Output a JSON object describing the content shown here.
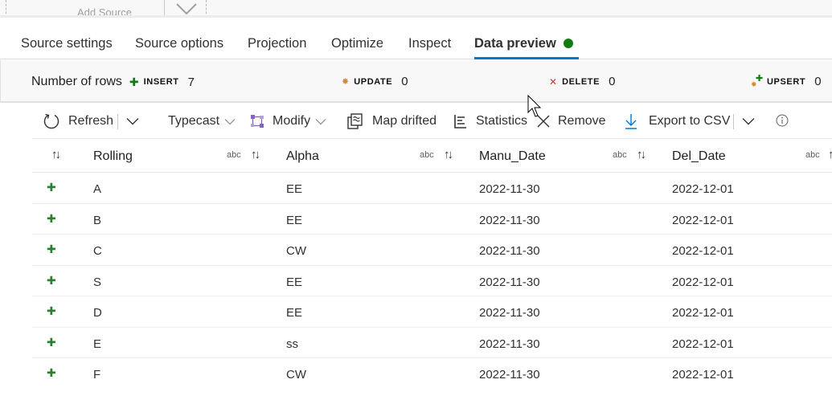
{
  "canvas": {
    "add_source_label": "Add Source"
  },
  "tabs": [
    {
      "label": "Source settings",
      "active": false
    },
    {
      "label": "Source options",
      "active": false
    },
    {
      "label": "Projection",
      "active": false
    },
    {
      "label": "Optimize",
      "active": false
    },
    {
      "label": "Inspect",
      "active": false
    },
    {
      "label": "Data preview",
      "active": true,
      "status": "green-dot"
    }
  ],
  "summary": {
    "title": "Number of rows",
    "insert": {
      "label": "INSERT",
      "count": "7",
      "icon": "plus-icon"
    },
    "update": {
      "label": "UPDATE",
      "count": "0",
      "icon": "sun-icon"
    },
    "delete": {
      "label": "DELETE",
      "count": "0",
      "icon": "x-icon"
    },
    "upsert": {
      "label": "UPSERT",
      "count": "0",
      "icon": "upsert-icon"
    }
  },
  "toolbar": {
    "refresh": "Refresh",
    "typecast": "Typecast",
    "modify": "Modify",
    "map_drifted": "Map drifted",
    "statistics": "Statistics",
    "remove": "Remove",
    "export_csv": "Export to CSV"
  },
  "table": {
    "columns": [
      {
        "name": "Rolling",
        "type": "abc"
      },
      {
        "name": "Alpha",
        "type": "abc"
      },
      {
        "name": "Manu_Date",
        "type": "abc"
      },
      {
        "name": "Del_Date",
        "type": "abc"
      }
    ],
    "rows": [
      {
        "Rolling": "A",
        "Alpha": "EE",
        "Manu_Date": "2022-11-30",
        "Del_Date": "2022-12-01"
      },
      {
        "Rolling": "B",
        "Alpha": "EE",
        "Manu_Date": "2022-11-30",
        "Del_Date": "2022-12-01"
      },
      {
        "Rolling": "C",
        "Alpha": "CW",
        "Manu_Date": "2022-11-30",
        "Del_Date": "2022-12-01"
      },
      {
        "Rolling": "S",
        "Alpha": "EE",
        "Manu_Date": "2022-11-30",
        "Del_Date": "2022-12-01"
      },
      {
        "Rolling": "D",
        "Alpha": "EE",
        "Manu_Date": "2022-11-30",
        "Del_Date": "2022-12-01"
      },
      {
        "Rolling": "E",
        "Alpha": "ss",
        "Manu_Date": "2022-11-30",
        "Del_Date": "2022-12-01"
      },
      {
        "Rolling": "F",
        "Alpha": "CW",
        "Manu_Date": "2022-11-30",
        "Del_Date": "2022-12-01"
      }
    ]
  },
  "colors": {
    "accent": "#0078d4",
    "insert_green": "#107c10",
    "update_orange": "#d38a2c",
    "delete_red": "#d13438",
    "modify_purple": "#8661c5"
  }
}
